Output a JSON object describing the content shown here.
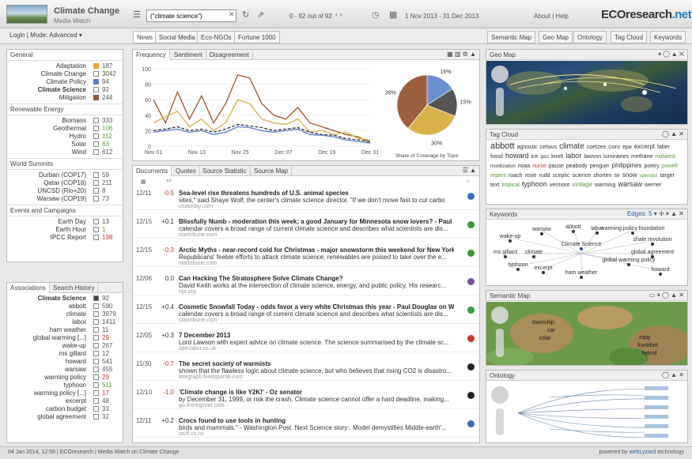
{
  "app": {
    "title": "Climate Change",
    "subtitle": "Media Watch",
    "brand": "ECOresearch",
    "brand_suffix": ".net"
  },
  "toolbar": {
    "search_value": "(\"climate science\")",
    "results": "0 - 92 out of 92",
    "daterange": "1 Nov 2013 - 31 Dec 2013",
    "about": "About | Help"
  },
  "nav": {
    "login": "Login | Mode: Advanced ▾",
    "left_tabs": [
      "News",
      "Social Media",
      "Eco-NGOs",
      "Fortune 1000"
    ],
    "right_tabs": [
      "Semantic Map",
      "Geo Map",
      "Ontology",
      "Tag Cloud",
      "Keywords"
    ]
  },
  "filters": {
    "general_title": "General",
    "general": [
      {
        "label": "Adaptation",
        "count": "187",
        "color": "#e8a33a"
      },
      {
        "label": "Climate Change",
        "count": "3042",
        "color": ""
      },
      {
        "label": "Climate Policy",
        "count": "94",
        "color": "#5b7fc4"
      },
      {
        "label": "Climate Science",
        "count": "92",
        "color": ""
      },
      {
        "label": "Mitigation",
        "count": "244",
        "color": "#8b5a3a"
      }
    ],
    "energy_title": "Renewable Energy",
    "energy": [
      {
        "label": "Biomass",
        "count": "333"
      },
      {
        "label": "Geothermal",
        "count": "106"
      },
      {
        "label": "Hydro",
        "count": "112"
      },
      {
        "label": "Solar",
        "count": "63"
      },
      {
        "label": "Wind",
        "count": "612"
      }
    ],
    "summits_title": "World Summits",
    "summits": [
      {
        "label": "Durban (COP17)",
        "count": "59"
      },
      {
        "label": "Qatar (COP18)",
        "count": "211"
      },
      {
        "label": "UNCSD (Rio+20)",
        "count": "8"
      },
      {
        "label": "Warsaw (COP19)",
        "count": "73"
      }
    ],
    "events_title": "Events and Campaigns",
    "events": [
      {
        "label": "Earth Day",
        "count": "13"
      },
      {
        "label": "Earth Hour",
        "count": "1"
      },
      {
        "label": "IPCC Report",
        "count": "198"
      }
    ]
  },
  "associations": {
    "tabs": [
      "Associations",
      "Search History"
    ],
    "items": [
      {
        "label": "Climate Science",
        "count": "92"
      },
      {
        "label": "abbott",
        "count": "590"
      },
      {
        "label": "climate",
        "count": "3979"
      },
      {
        "label": "labor",
        "count": "1411"
      },
      {
        "label": "ham weather",
        "count": "11"
      },
      {
        "label": "global warming [...]",
        "count": "29"
      },
      {
        "label": "wake-up",
        "count": "267"
      },
      {
        "label": "ms gillard",
        "count": "12"
      },
      {
        "label": "howard",
        "count": "541"
      },
      {
        "label": "warsaw",
        "count": "455"
      },
      {
        "label": "warming policy",
        "count": "29"
      },
      {
        "label": "typhoon",
        "count": "511"
      },
      {
        "label": "warming policy [...]",
        "count": "17"
      },
      {
        "label": "excerpt",
        "count": "48"
      },
      {
        "label": "carbon budget",
        "count": "33"
      },
      {
        "label": "global agreement",
        "count": "32"
      }
    ]
  },
  "chart_panel": {
    "tabs": [
      "Frequency",
      "Sentiment",
      "Disagreement"
    ],
    "pie_caption": "Share of Coverage by Topic"
  },
  "chart_data": [
    {
      "type": "line",
      "x": [
        "Nov 01",
        "Nov 13",
        "Nov 25",
        "Dec 07",
        "Dec 19",
        "Dec 31"
      ],
      "ylim": [
        0,
        100
      ],
      "yticks": [
        0,
        20,
        40,
        60,
        80,
        100
      ],
      "series": [
        {
          "color": "#a0522d",
          "values": [
            60,
            30,
            70,
            35,
            65,
            30,
            55,
            92,
            88,
            55,
            40,
            35,
            50,
            30,
            25,
            20,
            15,
            12,
            5
          ]
        },
        {
          "color": "#d4b24a",
          "values": [
            30,
            38,
            45,
            25,
            35,
            20,
            30,
            60,
            55,
            35,
            30,
            28,
            35,
            18,
            20,
            15,
            18,
            10,
            8
          ]
        },
        {
          "color": "#333333",
          "dashed": true,
          "values": [
            20,
            22,
            25,
            20,
            22,
            18,
            22,
            28,
            26,
            24,
            20,
            22,
            24,
            18,
            15,
            14,
            10,
            8,
            6
          ]
        },
        {
          "color": "#5b7fc4",
          "values": [
            18,
            20,
            22,
            18,
            20,
            15,
            18,
            25,
            24,
            20,
            18,
            20,
            22,
            15,
            14,
            12,
            8,
            6,
            4
          ]
        }
      ]
    },
    {
      "type": "pie",
      "slices": [
        {
          "value": 16,
          "label": "16%",
          "color": "#6a8fd0"
        },
        {
          "value": 15,
          "label": "15%",
          "color": "#555555"
        },
        {
          "value": 30,
          "label": "30%",
          "color": "#d9b34a"
        },
        {
          "value": 39,
          "label": "39%",
          "color": "#9b6040"
        }
      ],
      "caption": "Share of Coverage by Topic"
    }
  ],
  "documents": {
    "tabs": [
      "Documents",
      "Quotes",
      "Source Statistic",
      "Source Map"
    ],
    "header_score": "+/-",
    "items": [
      {
        "date": "12/11",
        "score": "-0.5",
        "neg": true,
        "title": "Sea-level rise threatens hundreds of U.S. animal species",
        "snippet": "sites,\" said Shaye Wolf, the center's climate science director. \"If we don't move fast to cut carbo",
        "source": "usatoday.com",
        "icon": "#3a6fb0"
      },
      {
        "date": "12/15",
        "score": "+0.1",
        "neg": false,
        "title": "Blissfully Numb - moderation this week; a good January for Minnesota snow lovers? - Paul Do...",
        "snippet": "calendar covers a broad range of current climate science and describes what scientists are dis...",
        "source": "startribune.com",
        "icon": "#3a9a3a"
      },
      {
        "date": "12/15",
        "score": "-0.3",
        "neg": true,
        "title": "Arctic Myths - near-record cold for Christmas - major snowstorm this weekend for New York ...",
        "snippet": "Republicans' feeble efforts to attack climate science, renewables are poised to take over the e...",
        "source": "startribune.com",
        "icon": "#3a9a3a"
      },
      {
        "date": "12/06",
        "score": "0.0",
        "neg": false,
        "title": "Can Hacking The Stratosphere Solve Climate Change?",
        "snippet": "David Keith works at the intersection of climate science, energy, and public policy. His researc...",
        "source": "npr.org",
        "icon": "#7a4fa0"
      },
      {
        "date": "12/15",
        "score": "+0.4",
        "neg": false,
        "title": "Cosmetic Snowfall Today - odds favor a very white Christmas this year - Paul Douglas on Wea...",
        "snippet": "calendar covers a broad range of current climate science and describes what scientists are dis...",
        "source": "startribune.com",
        "icon": "#3a9a3a"
      },
      {
        "date": "12/05",
        "score": "+0.3",
        "neg": false,
        "title": "7 December 2013",
        "snippet": "Lord Lawson with expert advice on climate science. The science summarised by the climate sc...",
        "source": "spectator.co.uk",
        "icon": "#c0392b"
      },
      {
        "date": "11/30",
        "score": "-0.7",
        "neg": true,
        "title": "The secret society of warmists",
        "snippet": "shown that the flawless logic about climate science, but who believes that rising CO2 is disastro...",
        "source": "telegraph.feedsportal.com",
        "icon": "#222222"
      },
      {
        "date": "12/10",
        "score": "-1.0",
        "neg": true,
        "title": "'Climate change is like Y2K!' - Oz senator",
        "snippet": "by December 31, 1999, or risk the crash. Climate science cannot offer a hard deadline, making...",
        "source": "go.theregister.com",
        "icon": "#222222"
      },
      {
        "date": "12/11",
        "score": "+0.2",
        "neg": false,
        "title": "Crocs found to use tools in hunting",
        "snippet": "birds and mammals.\" - Washington Post. Next Science story:. Model demystifies Middle-earth'...",
        "source": "stuff.co.nz",
        "icon": "#3a6fb0"
      }
    ]
  },
  "right": {
    "geo_title": "Geo Map",
    "tagcloud_title": "Tag Cloud",
    "tags": [
      {
        "t": "abbott",
        "s": 11,
        "c": "#333"
      },
      {
        "t": "agnostic",
        "s": 7,
        "c": "#333"
      },
      {
        "t": "celsius",
        "s": 7,
        "c": "#333"
      },
      {
        "t": "climate",
        "s": 10,
        "c": "#333"
      },
      {
        "t": "coetzee",
        "s": 7,
        "c": "#333"
      },
      {
        "t": "csiro",
        "s": 7,
        "c": "#333"
      },
      {
        "t": "epa",
        "s": 7,
        "c": "#333"
      },
      {
        "t": "excerpt",
        "s": 8,
        "c": "#333"
      },
      {
        "t": "faber",
        "s": 7,
        "c": "#333"
      },
      {
        "t": "fossil",
        "s": 7,
        "c": "#333"
      },
      {
        "t": "howard",
        "s": 9,
        "c": "#333"
      },
      {
        "t": "ice",
        "s": 7,
        "c": "#333"
      },
      {
        "t": "ipcc",
        "s": 6,
        "c": "#333"
      },
      {
        "t": "knott",
        "s": 7,
        "c": "#333"
      },
      {
        "t": "labor",
        "s": 9,
        "c": "#333"
      },
      {
        "t": "lawson",
        "s": 7,
        "c": "#333"
      },
      {
        "t": "luminaries",
        "s": 7,
        "c": "#333"
      },
      {
        "t": "methane",
        "s": 7,
        "c": "#333"
      },
      {
        "t": "midwest",
        "s": 7,
        "c": "#5a9f3a"
      },
      {
        "t": "mobilization",
        "s": 6,
        "c": "#333"
      },
      {
        "t": "noaa",
        "s": 7,
        "c": "#333"
      },
      {
        "t": "nurse",
        "s": 7,
        "c": "#c0392b"
      },
      {
        "t": "pause",
        "s": 7,
        "c": "#333"
      },
      {
        "t": "peabody",
        "s": 7,
        "c": "#333"
      },
      {
        "t": "penguin",
        "s": 7,
        "c": "#333"
      },
      {
        "t": "philippines",
        "s": 8,
        "c": "#333"
      },
      {
        "t": "poetry",
        "s": 7,
        "c": "#333"
      },
      {
        "t": "powell",
        "s": 7,
        "c": "#5a9f3a"
      },
      {
        "t": "repent",
        "s": 7,
        "c": "#5a9f3a"
      },
      {
        "t": "roach",
        "s": 7,
        "c": "#333"
      },
      {
        "t": "rosie",
        "s": 7,
        "c": "#333"
      },
      {
        "t": "rudd",
        "s": 7,
        "c": "#333"
      },
      {
        "t": "sceptic",
        "s": 7,
        "c": "#333"
      },
      {
        "t": "science",
        "s": 7,
        "c": "#333"
      },
      {
        "t": "shorten",
        "s": 7,
        "c": "#333"
      },
      {
        "t": "sir",
        "s": 7,
        "c": "#333"
      },
      {
        "t": "snow",
        "s": 8,
        "c": "#333"
      },
      {
        "t": "splendor",
        "s": 6,
        "c": "#5a9f3a"
      },
      {
        "t": "target",
        "s": 7,
        "c": "#333"
      },
      {
        "t": "text",
        "s": 7,
        "c": "#333"
      },
      {
        "t": "tropical",
        "s": 7,
        "c": "#5a9f3a"
      },
      {
        "t": "typhoon",
        "s": 9,
        "c": "#333"
      },
      {
        "t": "vermont",
        "s": 7,
        "c": "#333"
      },
      {
        "t": "vintage",
        "s": 8,
        "c": "#5a9f3a"
      },
      {
        "t": "warming",
        "s": 7,
        "c": "#333"
      },
      {
        "t": "warsaw",
        "s": 9,
        "c": "#333"
      },
      {
        "t": "werner",
        "s": 7,
        "c": "#333"
      }
    ],
    "keywords_title": "Keywords",
    "keywords_edges": "Edges: 5 ▾",
    "kw_nodes": [
      {
        "t": "wake-up"
      },
      {
        "t": "warsaw"
      },
      {
        "t": "abbott"
      },
      {
        "t": "labor"
      },
      {
        "t": "warming policy foundation"
      },
      {
        "t": "shale revolution"
      },
      {
        "t": "ms gillard"
      },
      {
        "t": "climate"
      },
      {
        "t": "Climate Science"
      },
      {
        "t": "global agreement"
      },
      {
        "t": "typhoon"
      },
      {
        "t": "global warming policy"
      },
      {
        "t": "excerpt"
      },
      {
        "t": "ham weather"
      },
      {
        "t": "howard"
      }
    ],
    "semantic_title": "Semantic Map",
    "sem_labels": [
      "township",
      "car",
      "solar",
      "mpg",
      "frankfurt",
      "hybrid"
    ],
    "ontology_title": "Ontology"
  },
  "footer": {
    "left": "04 Jan 2014, 12:58 | ECOresearch | Media Watch on Climate Change",
    "right_prefix": "powered by ",
    "right_brand": "webLyzard",
    "right_suffix": " technology"
  }
}
